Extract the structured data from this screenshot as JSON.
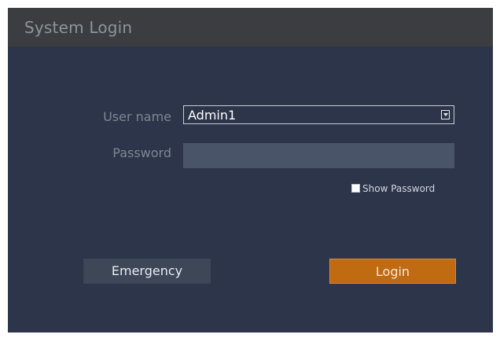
{
  "window": {
    "title": "System Login"
  },
  "form": {
    "username_label": "User name",
    "username_value": "Admin1",
    "password_label": "Password",
    "password_value": "",
    "show_password_label": "Show Password",
    "show_password_checked": false
  },
  "buttons": {
    "emergency_label": "Emergency",
    "login_label": "Login"
  },
  "colors": {
    "titlebar": "#3c3d40",
    "background": "#2c3549",
    "input": "#4a5468",
    "login_accent": "#c06a12",
    "secondary_button": "#3e4758"
  },
  "icons": {
    "dropdown": "chevron-down-icon",
    "checkbox": "checkbox-icon"
  }
}
